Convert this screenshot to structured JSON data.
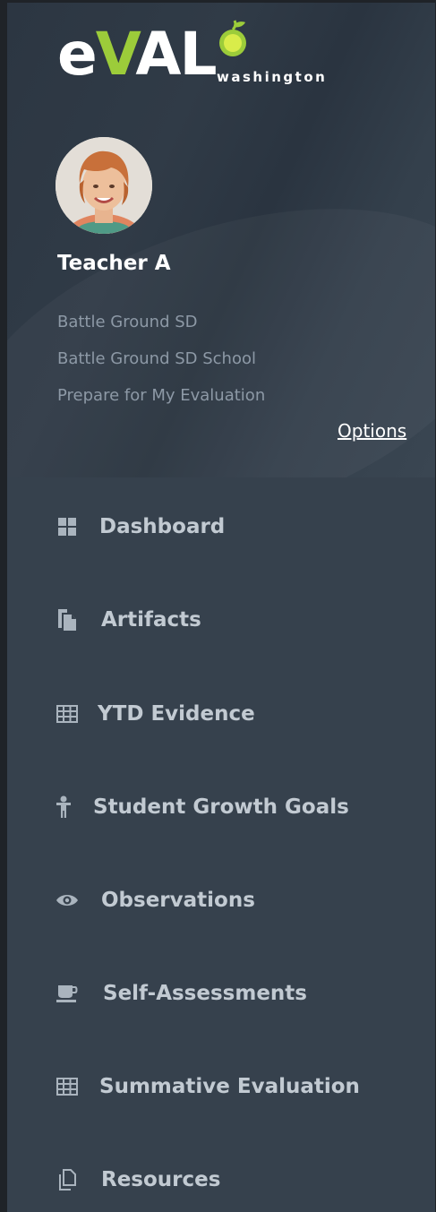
{
  "brand": {
    "logo_main_e": "e",
    "logo_main_v": "V",
    "logo_main_al": "AL",
    "logo_sub": "washington",
    "accent_green": "#9ccc3a"
  },
  "user": {
    "name": "Teacher A",
    "district": "Battle Ground SD",
    "school": "Battle Ground SD School",
    "workarea": "Prepare for My Evaluation",
    "options_label": "Options"
  },
  "nav": {
    "items": [
      {
        "label": "Dashboard",
        "icon": "dashboard-icon"
      },
      {
        "label": "Artifacts",
        "icon": "artifacts-icon"
      },
      {
        "label": "YTD Evidence",
        "icon": "table-icon"
      },
      {
        "label": "Student Growth Goals",
        "icon": "person-icon"
      },
      {
        "label": "Observations",
        "icon": "eye-icon"
      },
      {
        "label": "Self-Assessments",
        "icon": "coffee-icon"
      },
      {
        "label": "Summative Evaluation",
        "icon": "table-icon"
      },
      {
        "label": "Resources",
        "icon": "copy-icon"
      }
    ]
  },
  "colors": {
    "sidebar_bg": "#36414d",
    "nav_text": "#c2cad2",
    "nav_icon": "#aab4be",
    "muted_text": "#8d99a6"
  }
}
